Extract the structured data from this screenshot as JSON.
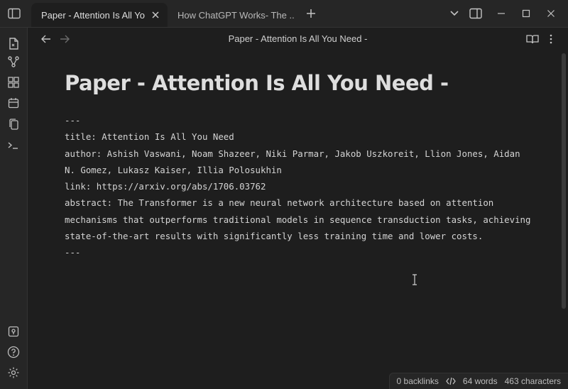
{
  "tabs": [
    {
      "label": "Paper - Attention Is All Yo...",
      "active": true
    },
    {
      "label": "How ChatGPT Works- The ...",
      "active": false
    }
  ],
  "titlebar": {
    "new_tab_icon": "plus-icon",
    "window_controls": [
      "chevron-down-icon",
      "split-view-icon",
      "minimize-icon",
      "maximize-icon",
      "close-icon"
    ]
  },
  "ribbon": {
    "top": [
      "file-icon",
      "graph-icon",
      "grid-icon",
      "calendar-icon",
      "copy-icon",
      "terminal-icon"
    ],
    "bottom": [
      "vault-icon",
      "help-icon",
      "settings-icon"
    ]
  },
  "view": {
    "title": "Paper - Attention Is All You Need -"
  },
  "note": {
    "heading": "Paper - Attention Is All You Need -",
    "frontmatter_open": "---",
    "title_line": "title: Attention Is All You Need",
    "author_line": "author: Ashish Vaswani, Noam Shazeer, Niki Parmar, Jakob Uszkoreit, Llion Jones, Aidan N. Gomez, Lukasz Kaiser, Illia Polosukhin",
    "link_line": "link: https://arxiv.org/abs/1706.03762",
    "abstract_line": "abstract: The Transformer is a new neural network architecture based on attention mechanisms that outperforms traditional models in sequence transduction tasks, achieving state-of-the-art results with significantly less training time and lower costs.",
    "frontmatter_close": "---"
  },
  "status": {
    "backlinks": "0 backlinks",
    "words": "64 words",
    "characters": "463 characters"
  },
  "colors": {
    "background": "#1e1e1e",
    "chrome": "#262626",
    "text": "#dadada"
  }
}
